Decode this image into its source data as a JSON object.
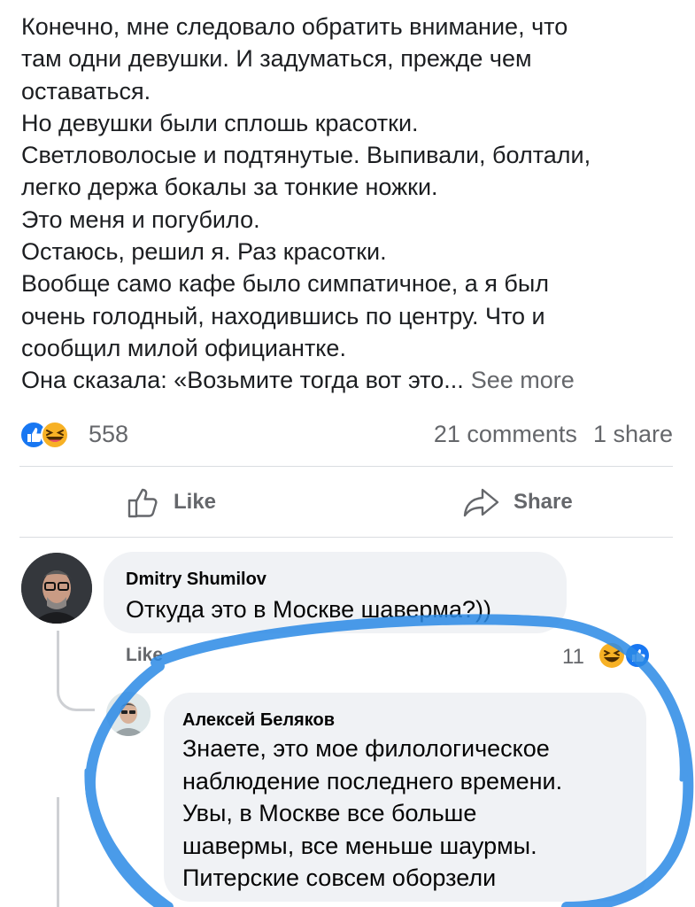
{
  "post": {
    "lines": [
      "Конечно, мне следовало обратить внимание, что",
      "там одни девушки. И задуматься, прежде чем",
      "оставаться.",
      "Но девушки были сплошь красотки.",
      "Светловолосые и подтянутые. Выпивали, болтали,",
      "легко держа бокалы за тонкие ножки.",
      "Это меня и погубило.",
      "Остаюсь, решил я. Раз красотки.",
      "Вообще само кафе было симпатичное, а я был",
      "очень голодный, находившись по центру. Что и",
      "сообщил милой официантке."
    ],
    "last_line": "Она сказала: «Возьмите тогда вот это...",
    "see_more": "See more"
  },
  "stats": {
    "reaction_count": "558",
    "comments": "21 comments",
    "shares": "1 share"
  },
  "actions": {
    "like": "Like",
    "share": "Share"
  },
  "comments": [
    {
      "author": "Dmitry Shumilov",
      "text": "Откуда это в Москве шаверма?))",
      "like_label": "Like",
      "reaction_count": "11"
    }
  ],
  "reply": {
    "author": "Алексей Беляков",
    "lines": [
      "Знаете, это мое филологическое",
      "наблюдение последнего времени.",
      "Увы, в Москве все больше",
      "шавермы, все меньше шаурмы.",
      "Питерские совсем оборзели"
    ]
  },
  "colors": {
    "like_blue": "#1877f2",
    "haha_yellow": "#f7b125",
    "scribble_blue": "#2b8ae6"
  }
}
